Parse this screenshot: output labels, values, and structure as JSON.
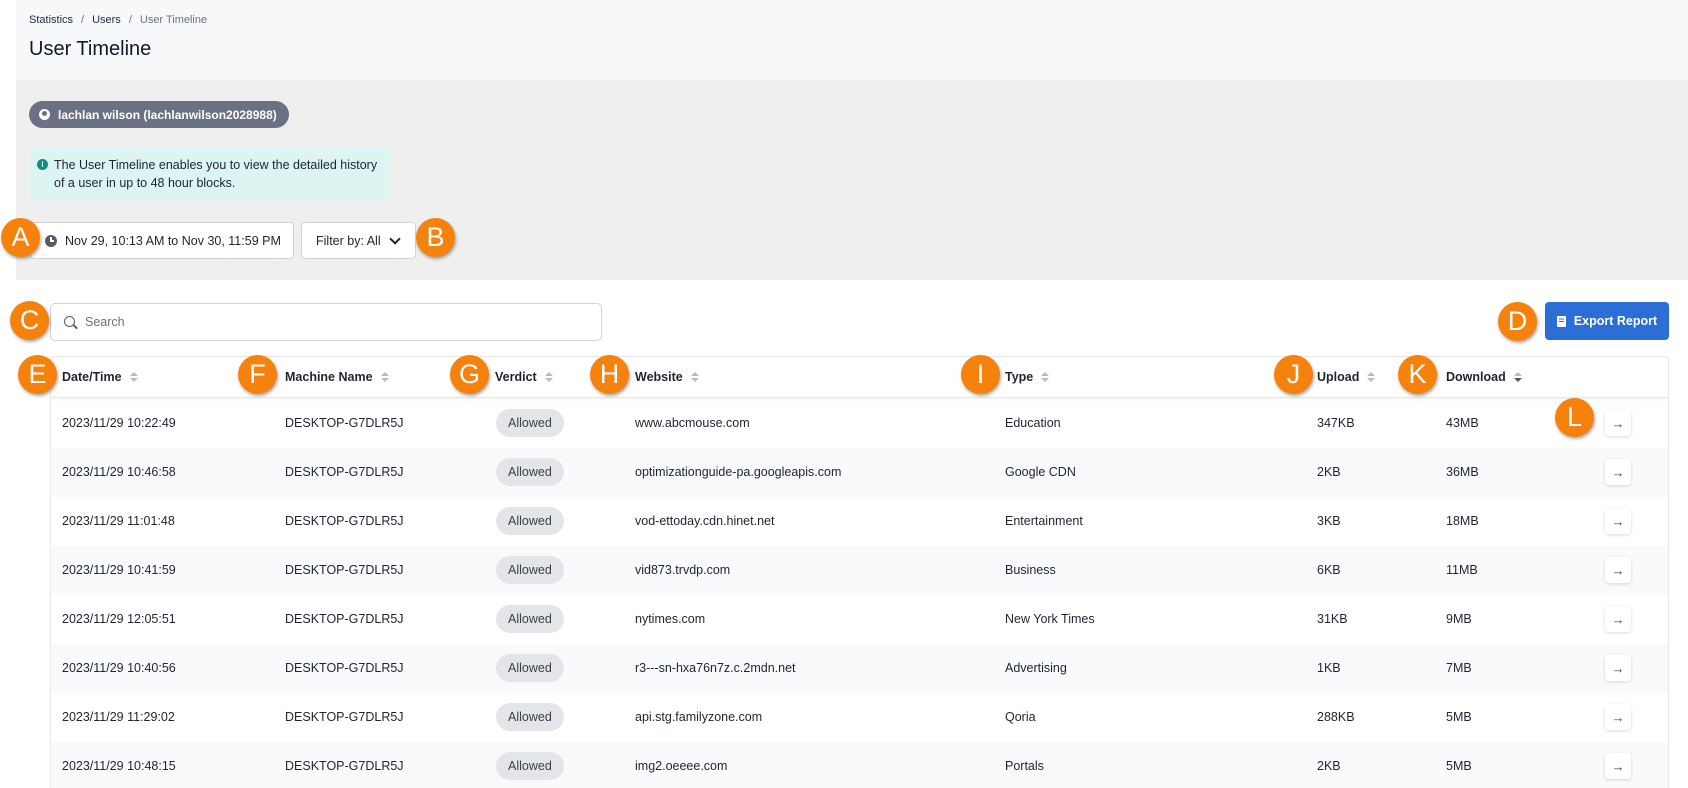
{
  "breadcrumb": [
    "Statistics",
    "Users",
    "User Timeline"
  ],
  "page_title": "User Timeline",
  "user_chip": "lachlan wilson (lachlanwilson2028988)",
  "info_text_line1": "The User Timeline enables you to view the detailed history",
  "info_text_line2": "of a user in up to 48 hour blocks.",
  "date_range": "Nov 29, 10:13 AM to Nov 30, 11:59 PM",
  "filter_label": "Filter by: All",
  "search_placeholder": "Search",
  "export_label": "Export Report",
  "columns": [
    "Date/Time",
    "Machine Name",
    "Verdict",
    "Website",
    "Type",
    "Upload",
    "Download"
  ],
  "rows": [
    {
      "datetime": "2023/11/29 10:22:49",
      "machine": "DESKTOP-G7DLR5J",
      "verdict": "Allowed",
      "website": "www.abcmouse.com",
      "type": "Education",
      "upload": "347KB",
      "download": "43MB"
    },
    {
      "datetime": "2023/11/29 10:46:58",
      "machine": "DESKTOP-G7DLR5J",
      "verdict": "Allowed",
      "website": "optimizationguide-pa.googleapis.com",
      "type": "Google CDN",
      "upload": "2KB",
      "download": "36MB"
    },
    {
      "datetime": "2023/11/29 11:01:48",
      "machine": "DESKTOP-G7DLR5J",
      "verdict": "Allowed",
      "website": "vod-ettoday.cdn.hinet.net",
      "type": "Entertainment",
      "upload": "3KB",
      "download": "18MB"
    },
    {
      "datetime": "2023/11/29 10:41:59",
      "machine": "DESKTOP-G7DLR5J",
      "verdict": "Allowed",
      "website": "vid873.trvdp.com",
      "type": "Business",
      "upload": "6KB",
      "download": "11MB"
    },
    {
      "datetime": "2023/11/29 12:05:51",
      "machine": "DESKTOP-G7DLR5J",
      "verdict": "Allowed",
      "website": "nytimes.com",
      "type": "New York Times",
      "upload": "31KB",
      "download": "9MB"
    },
    {
      "datetime": "2023/11/29 10:40:56",
      "machine": "DESKTOP-G7DLR5J",
      "verdict": "Allowed",
      "website": "r3---sn-hxa76n7z.c.2mdn.net",
      "type": "Advertising",
      "upload": "1KB",
      "download": "7MB"
    },
    {
      "datetime": "2023/11/29 11:29:02",
      "machine": "DESKTOP-G7DLR5J",
      "verdict": "Allowed",
      "website": "api.stg.familyzone.com",
      "type": "Qoria",
      "upload": "288KB",
      "download": "5MB"
    },
    {
      "datetime": "2023/11/29 10:48:15",
      "machine": "DESKTOP-G7DLR5J",
      "verdict": "Allowed",
      "website": "img2.oeeee.com",
      "type": "Portals",
      "upload": "2KB",
      "download": "5MB"
    }
  ],
  "row_action_icon": "arrow-right-icon",
  "annotation_markers": [
    "A",
    "B",
    "C",
    "D",
    "E",
    "F",
    "G",
    "H",
    "I",
    "J",
    "K",
    "L"
  ],
  "colors": {
    "primary": "#2b6fd6",
    "marker": "#f5820c",
    "chip": "#6b7183",
    "info_bg": "#dcf5f3"
  }
}
